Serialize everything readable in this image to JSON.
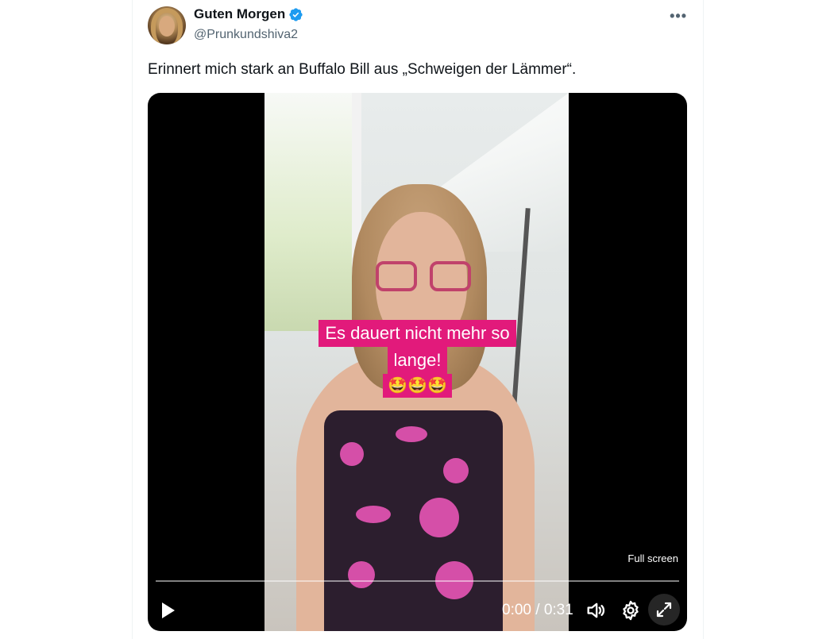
{
  "tweet": {
    "display_name": "Guten Morgen",
    "handle": "@Prunkundshiva2",
    "verified": true,
    "text": "Erinnert mich stark an Buffalo Bill aus „Schweigen der Lämmer“.",
    "more_icon": "more-horizontal-icon"
  },
  "video": {
    "caption_line1": "Es dauert nicht mehr so",
    "caption_line2": "lange!",
    "caption_emoji": "🤩🤩🤩",
    "fullscreen_tip": "Full screen",
    "time": "0:00 / 0:31",
    "progress": 0,
    "icons": {
      "play": "play-icon",
      "volume": "volume-icon",
      "settings": "gear-icon",
      "fullscreen": "expand-icon"
    }
  },
  "colors": {
    "verified_blue": "#1d9bf0",
    "caption_pink": "#e21a7b",
    "secondary_text": "#536471"
  }
}
